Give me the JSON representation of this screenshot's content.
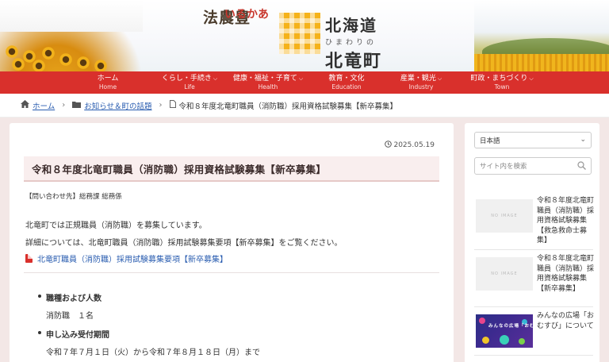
{
  "header": {
    "logo_vertical_col1": "豊農法",
    "logo_vertical_col2": "あかるい",
    "logo_vertical_col3": "",
    "logo_line1": "北海道",
    "logo_line2": "ひまわりの",
    "logo_line3": "北竜町"
  },
  "nav": {
    "items": [
      {
        "ja": "ホーム",
        "en": "Home",
        "has_menu": false
      },
      {
        "ja": "くらし・手続き",
        "en": "Life",
        "has_menu": true
      },
      {
        "ja": "健康・福祉・子育て",
        "en": "Health",
        "has_menu": true
      },
      {
        "ja": "教育・文化",
        "en": "Education",
        "has_menu": false
      },
      {
        "ja": "産業・観光",
        "en": "Industry",
        "has_menu": true
      },
      {
        "ja": "町政・まちづくり",
        "en": "Town",
        "has_menu": true
      }
    ]
  },
  "breadcrumb": {
    "home": "ホーム",
    "category": "お知らせ＆町の話題",
    "current": "令和８年度北竜町職員（消防職）採用資格試験募集【新卒募集】"
  },
  "article": {
    "date": "2025.05.19",
    "title": "令和８年度北竜町職員（消防職）採用資格試験募集【新卒募集】",
    "contact": "【問い合わせ先】総務課 総務係",
    "para1": "北竜町では正規職員（消防職）を募集しています。",
    "para2": "詳細については、北竜町職員（消防職）採用試験募集要項【新卒募集】をご覧ください。",
    "pdf_link": "北竜町職員（消防職）採用試験募集要項【新卒募集】",
    "list": [
      {
        "heading": "職種および人数",
        "value": "消防職　１名"
      },
      {
        "heading": "申し込み受付期間",
        "value": "令和７年７月１日（火）から令和７年８月１８日（月）まで"
      }
    ]
  },
  "sidebar": {
    "language": "日本語",
    "search_placeholder": "サイト内を検索",
    "posts": [
      {
        "title": "令和８年度北竜町職員（消防職）採用資格試験募集【救急救命士募集】",
        "thumb": "NO IMAGE"
      },
      {
        "title": "令和８年度北竜町職員（消防職）採用資格試験募集【新卒募集】",
        "thumb": "NO IMAGE"
      },
      {
        "title": "みんなの広場「おむすび」について",
        "thumb_text": "みんなの広場「おむすび」"
      }
    ]
  },
  "colors": {
    "nav_red": "#d9302c",
    "link_blue": "#2a5db0",
    "page_bg": "#f3e7e6",
    "title_bg": "#f9eeee"
  }
}
